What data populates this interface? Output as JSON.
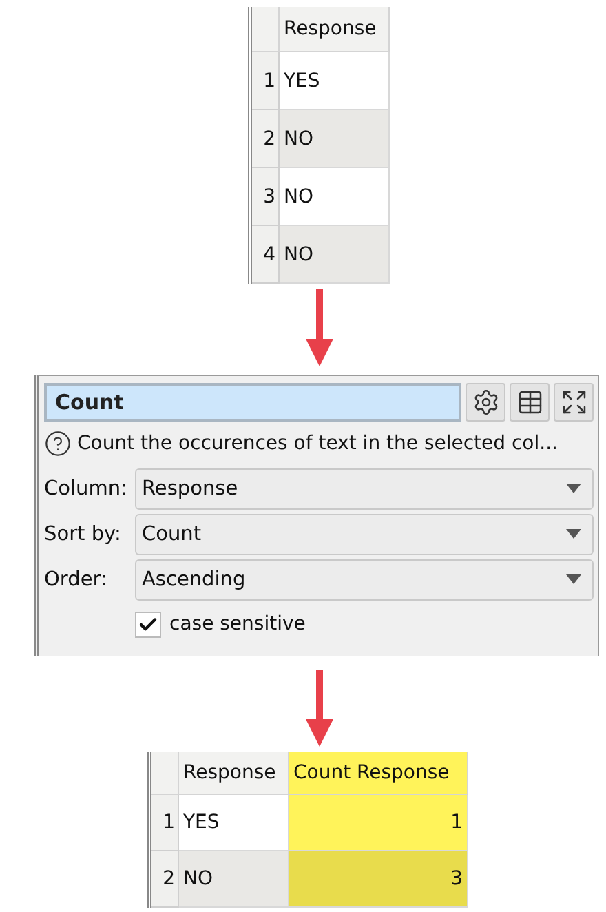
{
  "input_table": {
    "columns": [
      {
        "label": "Response",
        "highlighted": false
      }
    ],
    "rows": [
      {
        "number": "1",
        "cells": [
          "YES"
        ]
      },
      {
        "number": "2",
        "cells": [
          "NO"
        ]
      },
      {
        "number": "3",
        "cells": [
          "NO"
        ]
      },
      {
        "number": "4",
        "cells": [
          "NO"
        ]
      }
    ]
  },
  "tool_panel": {
    "title": "Count",
    "description": "Count the occurences of text in the selected col...",
    "fields": [
      {
        "label": "Column:",
        "value": "Response"
      },
      {
        "label": "Sort by:",
        "value": "Count"
      },
      {
        "label": "Order:",
        "value": "Ascending"
      }
    ],
    "checkbox": {
      "label": "case sensitive",
      "checked": true
    }
  },
  "output_table": {
    "columns": [
      {
        "label": "Response",
        "highlighted": false
      },
      {
        "label": "Count Response",
        "highlighted": true
      }
    ],
    "rows": [
      {
        "number": "1",
        "cells": [
          "YES",
          "1"
        ]
      },
      {
        "number": "2",
        "cells": [
          "NO",
          "3"
        ]
      }
    ]
  }
}
